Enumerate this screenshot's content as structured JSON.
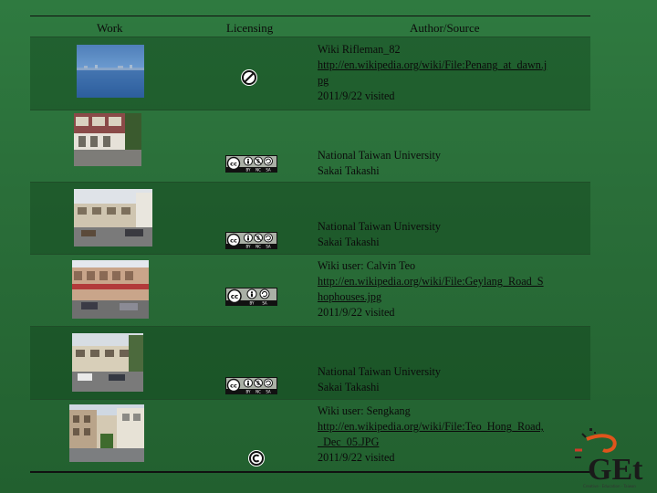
{
  "headers": {
    "work": "Work",
    "licensing": "Licensing",
    "author": "Author/Source"
  },
  "rows": [
    {
      "work": "penang-at-dawn-photo",
      "license": "public-domain-icon",
      "lines": [
        "Wiki  Rifleman_82"
      ],
      "link": "http://en.wikipedia.org/wiki/File:Penang_at_dawn.jpg",
      "link_lines": [
        "http://en.wikipedia.org/wiki/File:Penang_at_dawn.j",
        "pg"
      ],
      "date": "2011/9/22 visited"
    },
    {
      "work": "shophouse-street-photo",
      "license": "cc-by-nc-sa-icon",
      "lines": [
        "National Taiwan University",
        "Sakai Takashi"
      ]
    },
    {
      "work": "shophouse-street-photo-2",
      "license": "cc-by-nc-sa-icon",
      "lines": [
        "National Taiwan University",
        "Sakai Takashi"
      ]
    },
    {
      "work": "geylang-road-shophouses-photo",
      "license": "cc-by-sa-icon",
      "lines": [
        "Wiki  user: Calvin Teo"
      ],
      "link": "http://en.wikipedia.org/wiki/File:Geylang_Road_Shophouses.jpg",
      "link_lines": [
        "http://en.wikipedia.org/wiki/File:Geylang_Road_S",
        "hophouses.jpg"
      ],
      "date": "2011/9/22 visited"
    },
    {
      "work": "shophouse-street-photo-3",
      "license": "cc-by-nc-sa-icon",
      "lines": [
        "National Taiwan University",
        "Sakai Takashi"
      ]
    },
    {
      "work": "teo-hong-road-photo",
      "license": "copyright-icon",
      "lines": [
        "Wiki user: Sengkang"
      ],
      "link": "http://en.wikipedia.org/wiki/File:Teo_Hong_Road,_Dec_05.JPG",
      "link_lines": [
        "http://en.wikipedia.org/wiki/File:Teo_Hong_Road,",
        "_Dec_05.JPG"
      ],
      "date": "2011/9/22 visited"
    }
  ],
  "cc_labels": {
    "by": "BY",
    "nc": "NC",
    "sa": "SA",
    "cc": "cc"
  },
  "logo": {
    "text": "GEt",
    "tagline": "Creative · Education · Taiwan"
  },
  "colors": {
    "background": "#2a6e39",
    "text": "#0b0b0b"
  }
}
